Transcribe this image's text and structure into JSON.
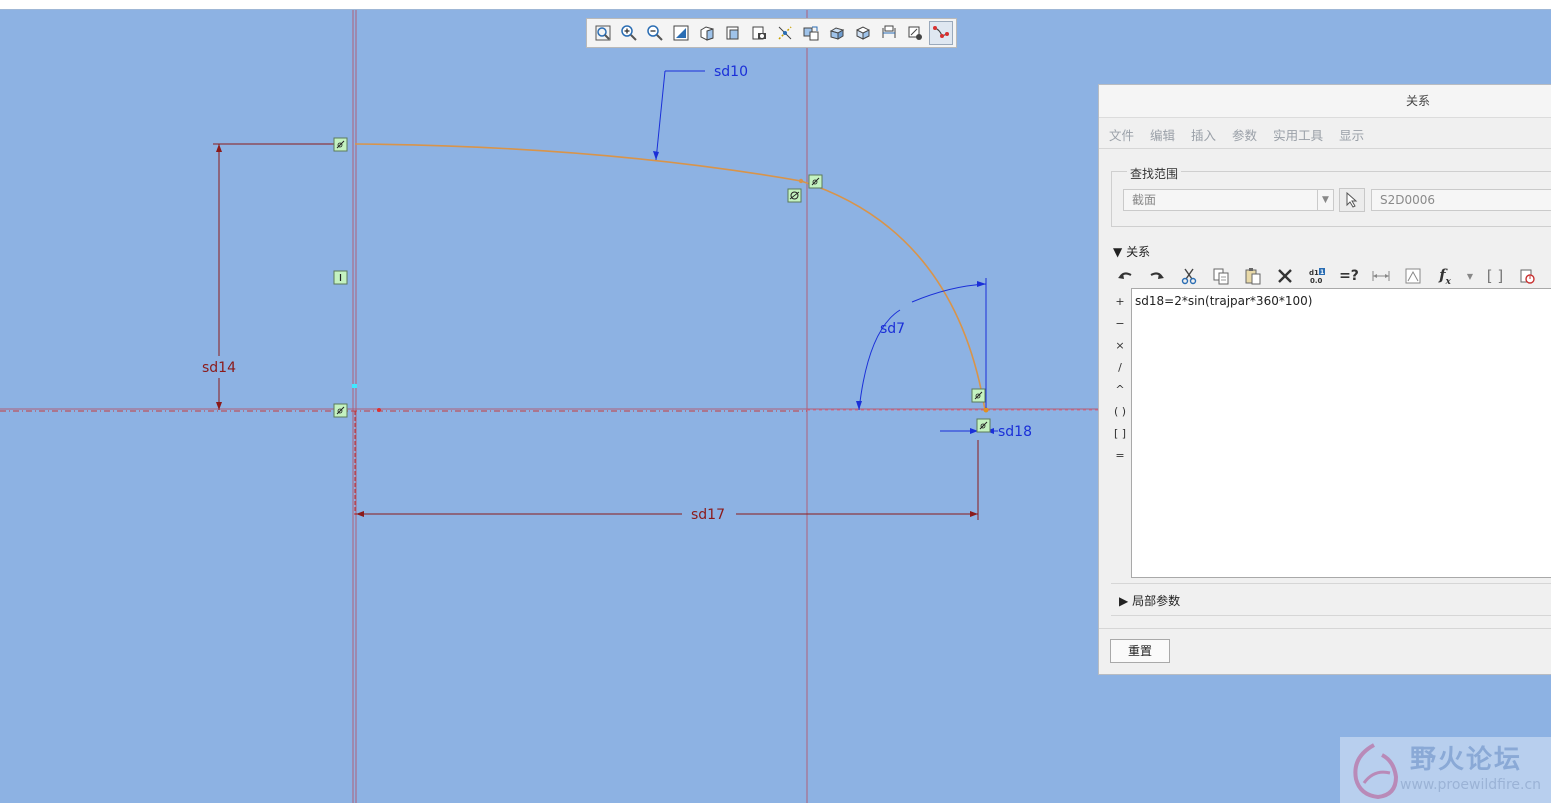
{
  "sketch": {
    "dimensions": {
      "sd10": "sd10",
      "sd7": "sd7",
      "sd14": "sd14",
      "sd17": "sd17",
      "sd18": "sd18"
    },
    "colors": {
      "background": "#8db2e3",
      "curve": "#d8944a",
      "dimension_driving": "#1a2fd8",
      "dimension_strong": "#8b1a1a",
      "centerline": "#b0607a",
      "constraint_fill": "#c4f2c0"
    }
  },
  "view_toolbar": {
    "icons": [
      "refit-icon",
      "zoom-in-icon",
      "zoom-out-icon",
      "repaint-icon",
      "display-style-icon",
      "saved-views-icon",
      "sketch-view-icon",
      "datum-display-icon",
      "annotation-display-icon",
      "shading-icon",
      "perspective-icon",
      "dimension-display-icon",
      "constraint-display-icon",
      "vertex-display-icon"
    ]
  },
  "dialog": {
    "title": "关系",
    "menu": [
      "文件",
      "编辑",
      "插入",
      "参数",
      "实用工具",
      "显示"
    ],
    "search_scope_label": "查找范围",
    "scope_value": "截面",
    "scope_name": "S2D0006",
    "relations_header": "关系",
    "operators": [
      "+",
      "−",
      "×",
      "/",
      "^",
      "( )",
      "[ ]",
      "="
    ],
    "relation_text": "sd18=2*sin(trajpar*360*100)",
    "local_params_label": "局部参数",
    "reset_label": "重置"
  },
  "watermark": {
    "title": "野火论坛",
    "url": "www.proewildfire.cn"
  }
}
